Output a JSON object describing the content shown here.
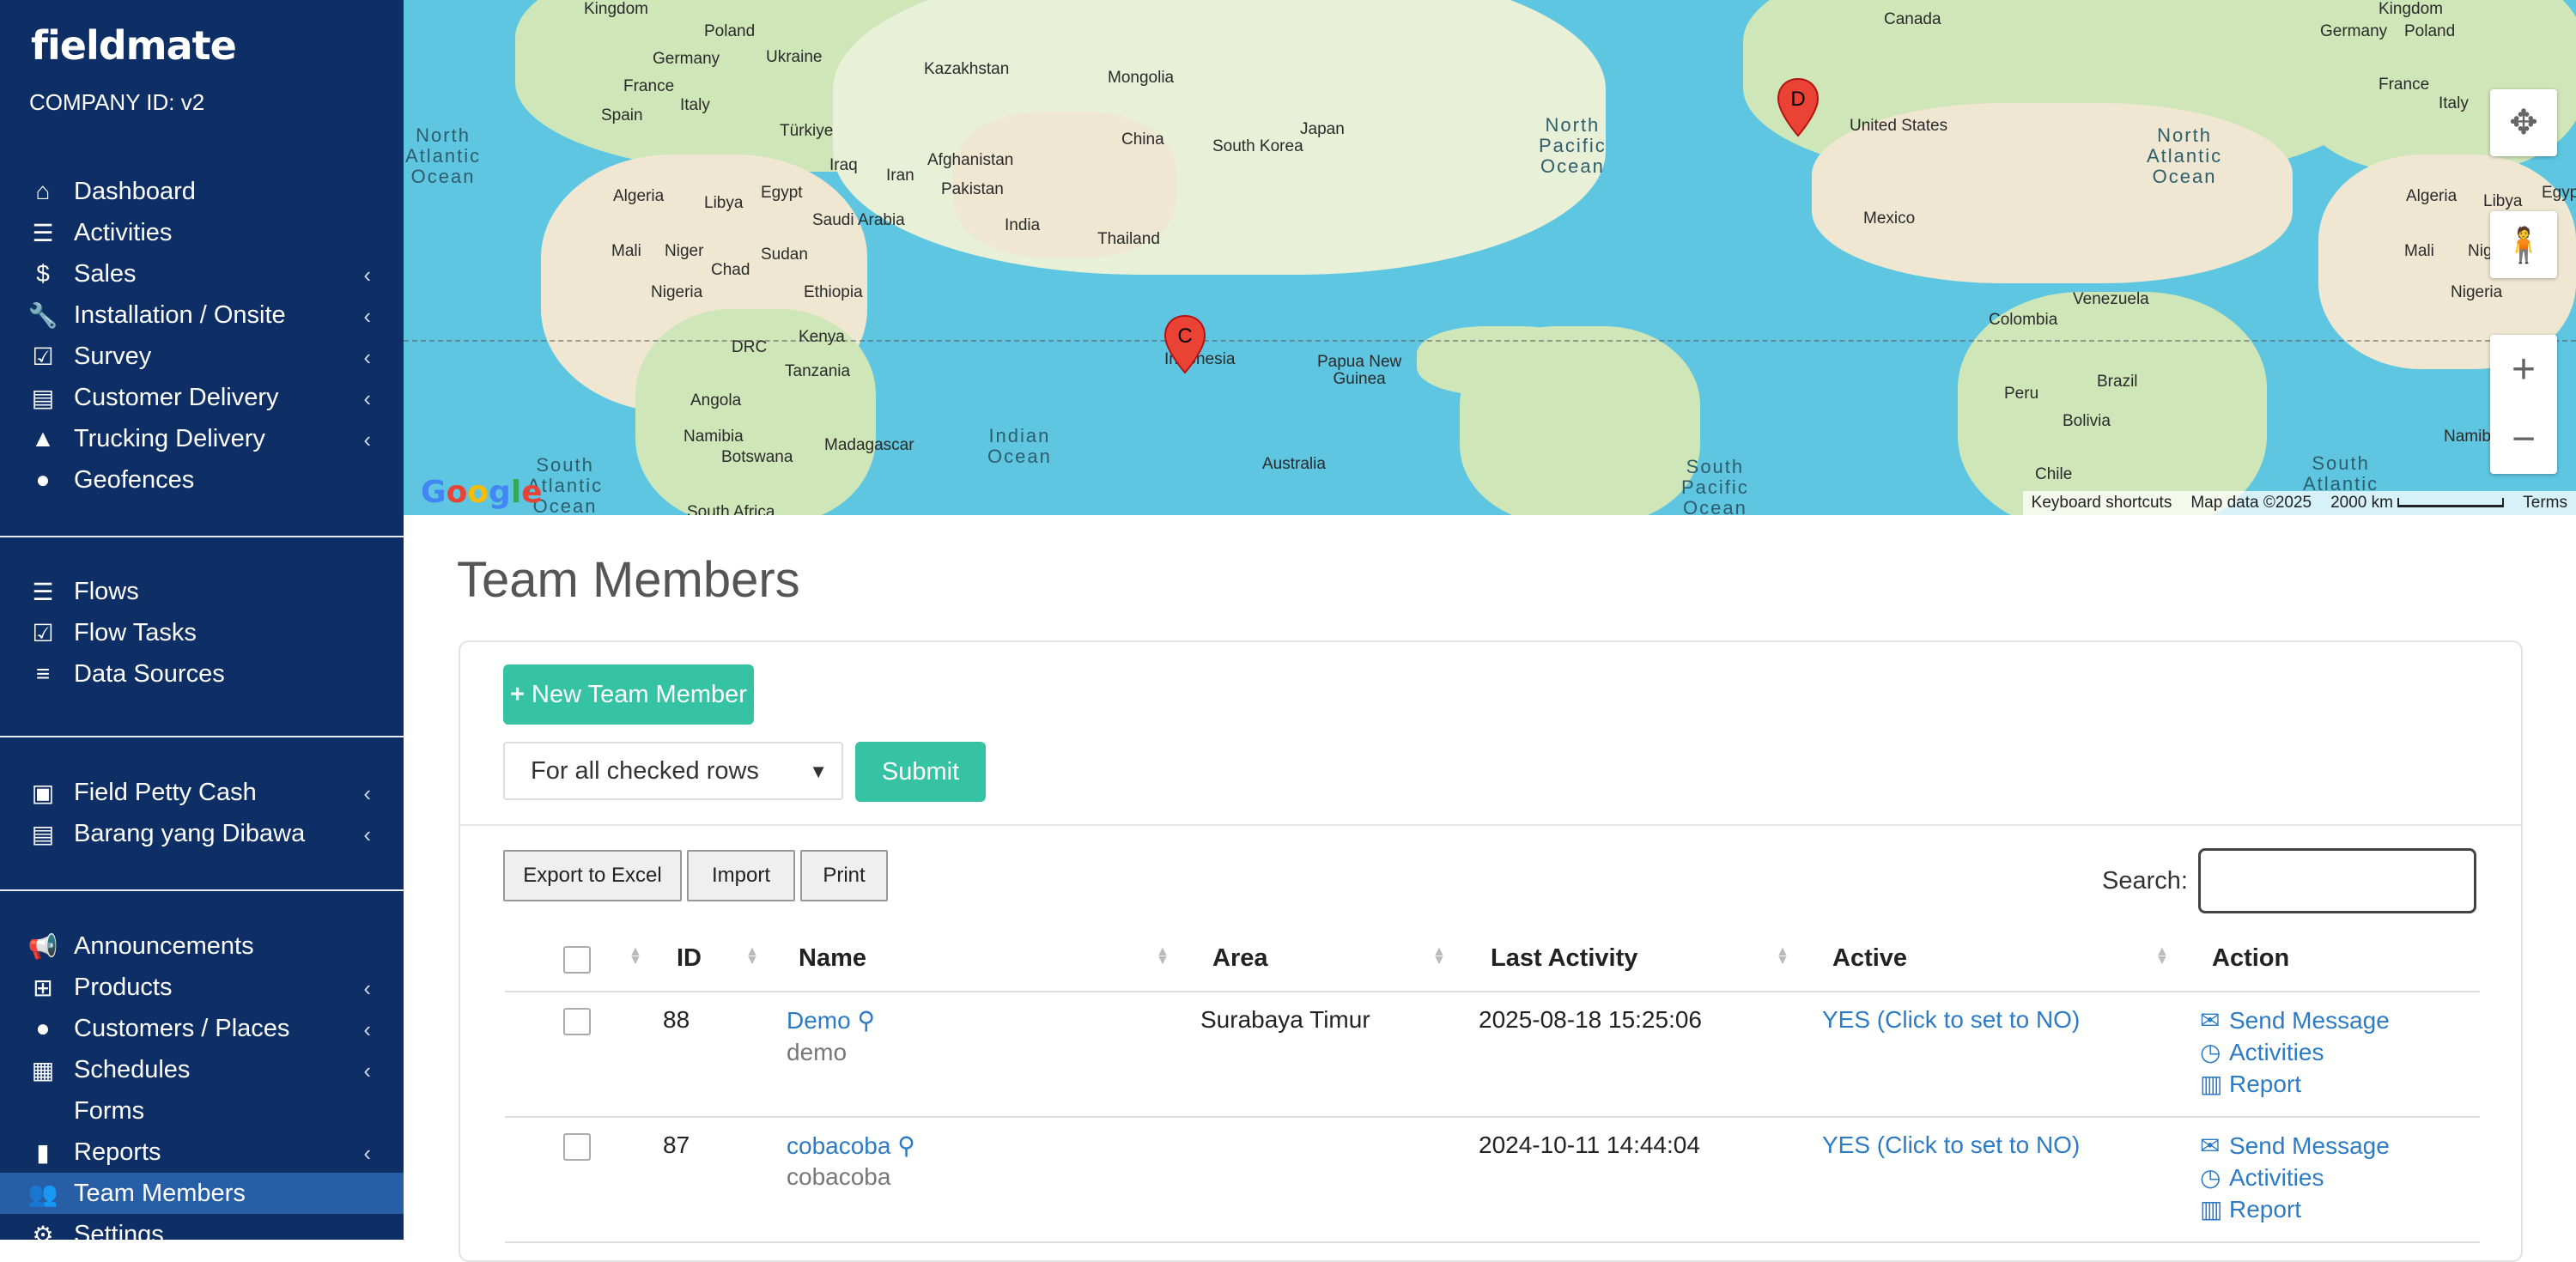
{
  "sidebar": {
    "logo": "fieldmate",
    "company_id": "COMPANY ID: v2",
    "items": [
      {
        "label": "Dashboard",
        "icon": "home-icon",
        "glyph": "⌂",
        "chevron": false
      },
      {
        "label": "Activities",
        "icon": "list-icon",
        "glyph": "☰",
        "chevron": false
      },
      {
        "label": "Sales",
        "icon": "dollar-icon",
        "glyph": "$",
        "chevron": true
      },
      {
        "label": "Installation / Onsite",
        "icon": "wrench-icon",
        "glyph": "🔧",
        "chevron": true
      },
      {
        "label": "Survey",
        "icon": "check-square-icon",
        "glyph": "☑",
        "chevron": true
      },
      {
        "label": "Customer Delivery",
        "icon": "archive-icon",
        "glyph": "▤",
        "chevron": true
      },
      {
        "label": "Trucking Delivery",
        "icon": "road-icon",
        "glyph": "▲",
        "chevron": true
      },
      {
        "label": "Geofences",
        "icon": "map-marker-icon",
        "glyph": "●",
        "chevron": false
      }
    ],
    "items2": [
      {
        "label": "Flows",
        "icon": "list-icon",
        "glyph": "☰"
      },
      {
        "label": "Flow Tasks",
        "icon": "check-square-icon",
        "glyph": "☑"
      },
      {
        "label": "Data Sources",
        "icon": "database-icon",
        "glyph": "≡"
      }
    ],
    "items3": [
      {
        "label": "Field Petty Cash",
        "icon": "money-icon",
        "glyph": "▣"
      },
      {
        "label": "Barang yang Dibawa",
        "icon": "archive-icon",
        "glyph": "▤"
      }
    ],
    "items4": [
      {
        "label": "Announcements",
        "icon": "bullhorn-icon",
        "glyph": "📢",
        "chevron": false
      },
      {
        "label": "Products",
        "icon": "sitemap-icon",
        "glyph": "⊞",
        "chevron": true
      },
      {
        "label": "Customers / Places",
        "icon": "map-marker-icon",
        "glyph": "●",
        "chevron": true
      },
      {
        "label": "Schedules",
        "icon": "calendar-icon",
        "glyph": "▦",
        "chevron": true
      },
      {
        "label": "Forms",
        "icon": "",
        "glyph": "",
        "chevron": false
      },
      {
        "label": "Reports",
        "icon": "bar-chart-icon",
        "glyph": "▮",
        "chevron": true
      },
      {
        "label": "Team Members",
        "icon": "users-icon",
        "glyph": "👥",
        "chevron": false
      },
      {
        "label": "Settings",
        "icon": "gears-icon",
        "glyph": "⚙",
        "chevron": false
      }
    ]
  },
  "map": {
    "labels": {
      "kingdom": "Kingdom",
      "poland": "Poland",
      "germany": "Germany",
      "ukraine": "Ukraine",
      "kazakhstan": "Kazakhstan",
      "mongolia": "Mongolia",
      "canada": "Canada",
      "france": "France",
      "spain": "Spain",
      "italy": "Italy",
      "turkiye": "Türkiye",
      "china": "China",
      "south_korea": "South Korea",
      "japan": "Japan",
      "united_states": "United States",
      "iraq": "Iraq",
      "iran": "Iran",
      "afghanistan": "Afghanistan",
      "pakistan": "Pakistan",
      "algeria": "Algeria",
      "libya": "Libya",
      "egypt": "Egypt",
      "saudi_arabia": "Saudi Arabia",
      "india": "India",
      "thailand": "Thailand",
      "mexico": "Mexico",
      "mali": "Mali",
      "niger": "Niger",
      "chad": "Chad",
      "sudan": "Sudan",
      "nigeria": "Nigeria",
      "ethiopia": "Ethiopia",
      "venezuela": "Venezuela",
      "colombia": "Colombia",
      "drc": "DRC",
      "kenya": "Kenya",
      "tanzania": "Tanzania",
      "indonesia": "Indonesia",
      "papua": "Papua New\nGuinea",
      "brazil": "Brazil",
      "peru": "Peru",
      "angola": "Angola",
      "namibia": "Namibia",
      "botswana": "Botswana",
      "madagascar": "Madagascar",
      "australia": "Australia",
      "bolivia": "Bolivia",
      "chile": "Chile",
      "south_africa": "South Africa"
    },
    "oceans": {
      "north_atlantic_left": "North\nAtlantic\nOcean",
      "north_pacific": "North\nPacific\nOcean",
      "north_atlantic_right": "North\nAtlantic\nOcean",
      "indian": "Indian\nOcean",
      "south_atlantic_left": "South\nAtlantic\nOcean",
      "south_pacific": "South\nPacific\nOcean",
      "south_atlantic_right": "South\nAtlantic"
    },
    "pins": [
      {
        "letter": "C"
      },
      {
        "letter": "D"
      }
    ],
    "google": "Google",
    "attribution": {
      "shortcuts": "Keyboard shortcuts",
      "data": "Map data ©2025",
      "scale": "2000 km",
      "terms": "Terms"
    },
    "zoom_in": "+",
    "zoom_out": "−"
  },
  "main": {
    "title": "Team Members",
    "new_button": "New Team Member",
    "bulk_select": "For all checked rows",
    "submit": "Submit",
    "export": "Export to Excel",
    "import": "Import",
    "print": "Print",
    "search_label": "Search:",
    "columns": [
      "ID",
      "Name",
      "Area",
      "Last Activity",
      "Active",
      "Action"
    ],
    "rows": [
      {
        "id": "88",
        "name": "Demo",
        "username": "demo",
        "area": "Surabaya Timur",
        "last_activity": "2025-08-18 15:25:06",
        "active": "YES (Click to set to NO)"
      },
      {
        "id": "87",
        "name": "cobacoba",
        "username": "cobacoba",
        "area": "",
        "last_activity": "2024-10-11 14:44:04",
        "active": "YES (Click to set to NO)"
      }
    ],
    "actions": {
      "message": "Send Message",
      "activities": "Activities",
      "report": "Report"
    }
  },
  "colors": {
    "sidebar": "#0e2e66",
    "active_item": "#275ea6",
    "accent": "#35c3a4",
    "link": "#2d7bc4",
    "pin": "#ea4335",
    "water": "#5ec6e0"
  }
}
